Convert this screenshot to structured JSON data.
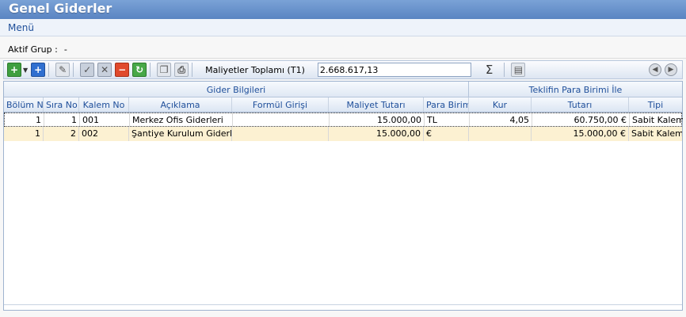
{
  "window": {
    "title": "Genel Giderler"
  },
  "menu": {
    "label": "Menü"
  },
  "group": {
    "label": "Aktif Grup :",
    "value": "-"
  },
  "toolbar": {
    "total_label": "Maliyetler Toplamı (T1)",
    "total_value": "2.668.617,13",
    "icons": [
      "add-icon",
      "dropdown-arrow-icon",
      "add-row-icon",
      "edit-icon",
      "check-icon",
      "cancel-icon",
      "delete-icon",
      "refresh-icon",
      "copy-icon",
      "print-icon",
      "sigma-icon",
      "export-icon",
      "prev-icon",
      "next-icon"
    ],
    "sigma": "Σ"
  },
  "grid": {
    "groups": [
      {
        "label": "Gider Bilgileri"
      },
      {
        "label": "Teklifin Para Birimi İle"
      }
    ],
    "columns": [
      "Bölüm No",
      "Sıra No",
      "Kalem No",
      "Açıklama",
      "Formül Girişi",
      "Maliyet Tutarı",
      "Para Birimi",
      "Kur",
      "Tutarı",
      "Tipi"
    ],
    "rows": [
      {
        "bolum": "1",
        "sira": "1",
        "kalem": "001",
        "aciklama": "Merkez Ofis Giderleri",
        "formul": "",
        "maliyet": "15.000,00",
        "para": "TL",
        "kur": "4,05",
        "tutar": "60.750,00 €",
        "tipi": "Sabit Kalem"
      },
      {
        "bolum": "1",
        "sira": "2",
        "kalem": "002",
        "aciklama": "Şantiye Kurulum Giderleri",
        "formul": "",
        "maliyet": "15.000,00",
        "para": "€",
        "kur": "",
        "tutar": "15.000,00 €",
        "tipi": "Sabit Kalem"
      }
    ]
  }
}
